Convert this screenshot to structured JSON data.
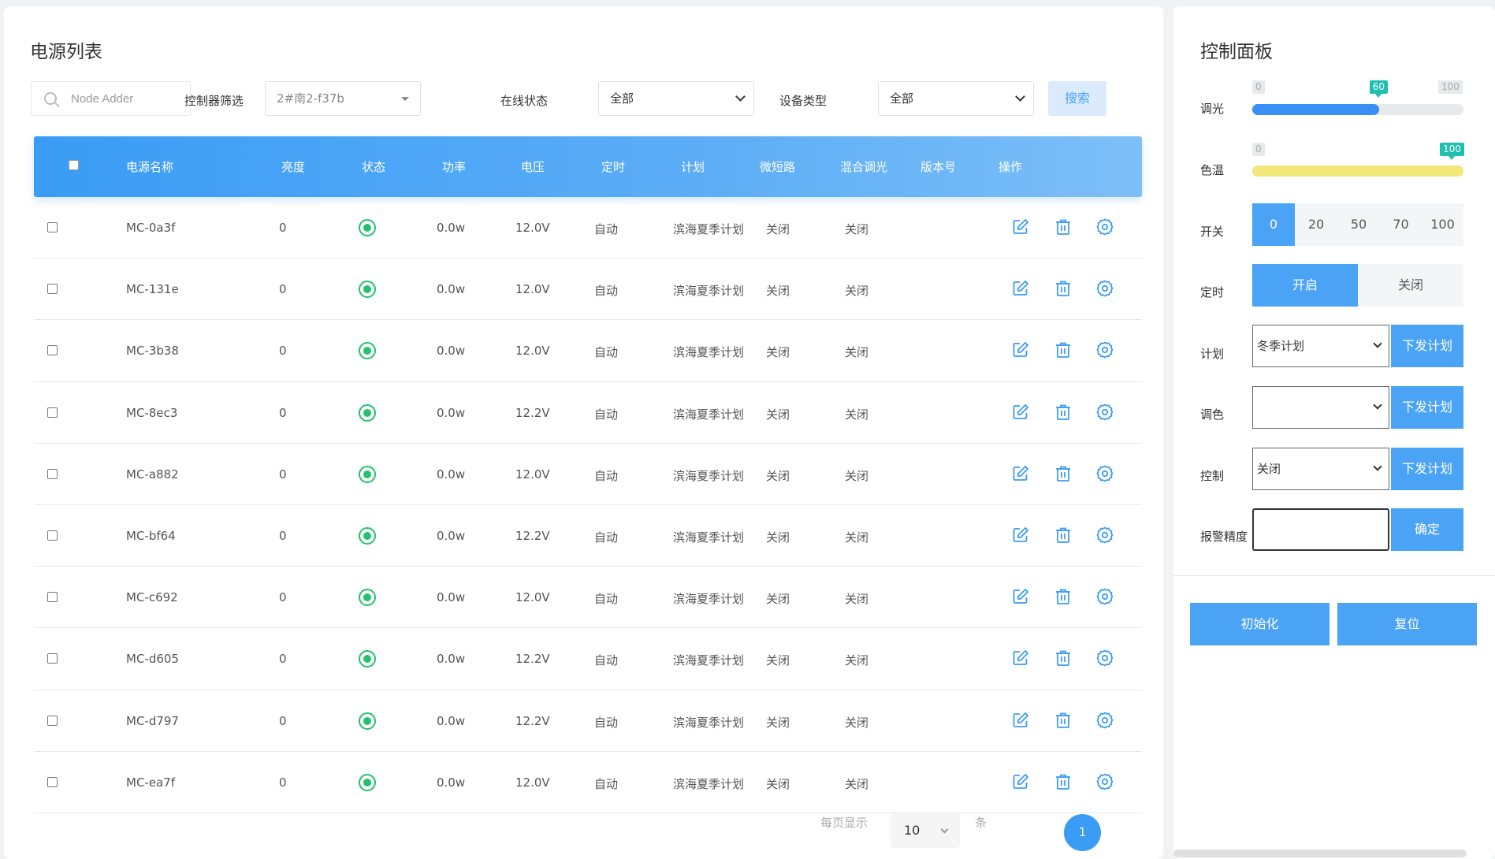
{
  "left": {
    "title": "电源列表",
    "search_placeholder": "Node Adder",
    "controller_filter_label": "控制器筛选",
    "controller_filter_value": "2#南2-f37b",
    "online_label": "在线状态",
    "online_value": "全部",
    "device_type_label": "设备类型",
    "device_type_value": "全部",
    "search_button": "搜索"
  },
  "table": {
    "headers": [
      "电源名称",
      "亮度",
      "状态",
      "功率",
      "电压",
      "定时",
      "计划",
      "微短路",
      "混合调光",
      "版本号",
      "操作"
    ],
    "rows": [
      {
        "name": "MC-0a3f",
        "brightness": "0",
        "power": "0.0w",
        "voltage": "12.0V",
        "timer": "自动",
        "plan": "滨海夏季计划",
        "short": "关闭",
        "mix": "关闭"
      },
      {
        "name": "MC-131e",
        "brightness": "0",
        "power": "0.0w",
        "voltage": "12.0V",
        "timer": "自动",
        "plan": "滨海夏季计划",
        "short": "关闭",
        "mix": "关闭"
      },
      {
        "name": "MC-3b38",
        "brightness": "0",
        "power": "0.0w",
        "voltage": "12.0V",
        "timer": "自动",
        "plan": "滨海夏季计划",
        "short": "关闭",
        "mix": "关闭"
      },
      {
        "name": "MC-8ec3",
        "brightness": "0",
        "power": "0.0w",
        "voltage": "12.2V",
        "timer": "自动",
        "plan": "滨海夏季计划",
        "short": "关闭",
        "mix": "关闭"
      },
      {
        "name": "MC-a882",
        "brightness": "0",
        "power": "0.0w",
        "voltage": "12.0V",
        "timer": "自动",
        "plan": "滨海夏季计划",
        "short": "关闭",
        "mix": "关闭"
      },
      {
        "name": "MC-bf64",
        "brightness": "0",
        "power": "0.0w",
        "voltage": "12.2V",
        "timer": "自动",
        "plan": "滨海夏季计划",
        "short": "关闭",
        "mix": "关闭"
      },
      {
        "name": "MC-c692",
        "brightness": "0",
        "power": "0.0w",
        "voltage": "12.0V",
        "timer": "自动",
        "plan": "滨海夏季计划",
        "short": "关闭",
        "mix": "关闭"
      },
      {
        "name": "MC-d605",
        "brightness": "0",
        "power": "0.0w",
        "voltage": "12.2V",
        "timer": "自动",
        "plan": "滨海夏季计划",
        "short": "关闭",
        "mix": "关闭"
      },
      {
        "name": "MC-d797",
        "brightness": "0",
        "power": "0.0w",
        "voltage": "12.2V",
        "timer": "自动",
        "plan": "滨海夏季计划",
        "short": "关闭",
        "mix": "关闭"
      },
      {
        "name": "MC-ea7f",
        "brightness": "0",
        "power": "0.0w",
        "voltage": "12.0V",
        "timer": "自动",
        "plan": "滨海夏季计划",
        "short": "关闭",
        "mix": "关闭"
      }
    ]
  },
  "pager": {
    "per_page_label": "每页显示",
    "per_page_value": "10",
    "unit": "条",
    "current_page": "1"
  },
  "control": {
    "title": "控制面板",
    "dimming_label": "调光",
    "dimming": {
      "min": "0",
      "value": "60",
      "max": "100",
      "fraction": 0.6
    },
    "color_temp_label": "色温",
    "color_temp": {
      "min": "0",
      "value": "100",
      "max": "100",
      "fraction": 1.0
    },
    "switch_label": "开关",
    "switch_options": [
      "0",
      "20",
      "50",
      "70",
      "100"
    ],
    "switch_selected": "0",
    "timer_label": "定时",
    "timer_on": "开启",
    "timer_off": "关闭",
    "plan_label": "计划",
    "plan_value": "冬季计划",
    "color_label": "调色",
    "color_value": "",
    "ctrl_label": "控制",
    "ctrl_value": "关闭",
    "issue_button": "下发计划",
    "alarm_label": "报警精度",
    "alarm_value": "",
    "confirm_button": "确定",
    "init_button": "初始化",
    "reset_button": "复位"
  },
  "colors": {
    "primary": "#4aa3f5",
    "status_on": "#23c26b",
    "dimming_fill": "#3a8ff5",
    "color_temp_fill": "#f4e77a",
    "tag": "#1fbfb0"
  }
}
